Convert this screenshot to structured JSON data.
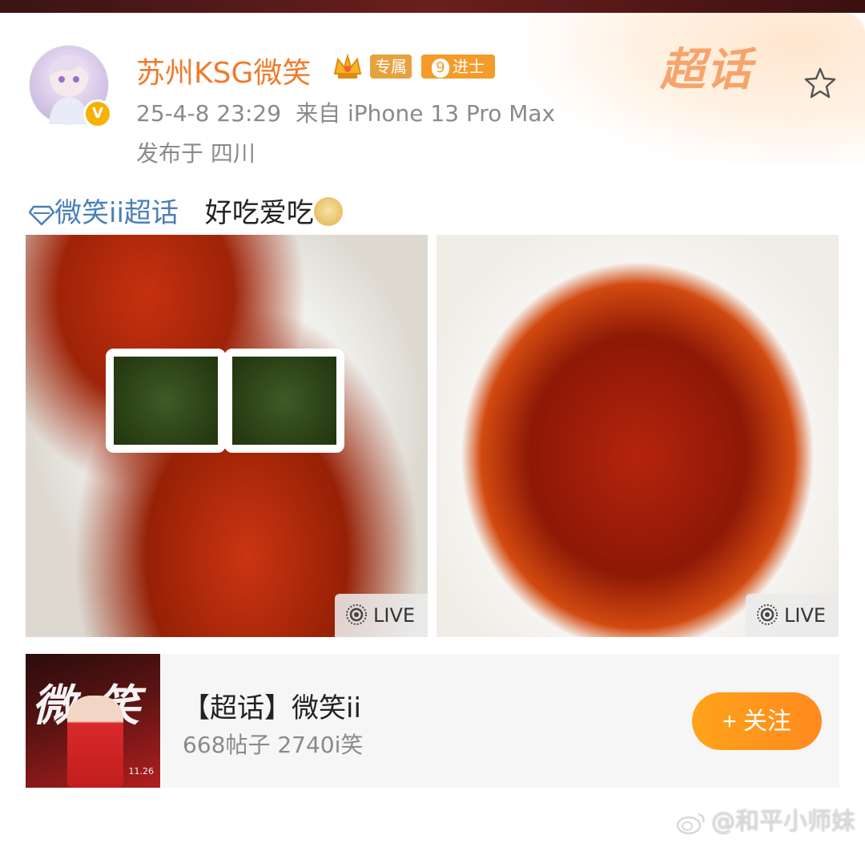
{
  "post": {
    "username": "苏州KSG微笑",
    "badges": {
      "exclusive": "专属",
      "level": "9",
      "level_title": "进士"
    },
    "datetime": "25-4-8 23:29",
    "source": "来自 iPhone 13 Pro Max",
    "location": "发布于 四川",
    "topic_link": "微笑ii超话",
    "text": "好吃爱吃",
    "header_logo": "超话",
    "icons": {
      "verified": "verified-badge-icon",
      "crown": "crown-icon",
      "star": "star-icon",
      "topic": "diamond-icon",
      "emoji": "doge-emoji"
    }
  },
  "photos": [
    {
      "label": "LIVE"
    },
    {
      "label": "LIVE"
    }
  ],
  "topic_card": {
    "title": "【超话】微笑ii",
    "stats": "668帖子 2740i笑",
    "follow_label": "+ 关注",
    "thumb_text": "微 笑",
    "thumb_date": "11.26"
  },
  "watermark": {
    "text": "@和平小师妹"
  },
  "colors": {
    "username": "#f07b2a",
    "topic_link": "#4a7fb8",
    "follow_button": "#ff9a1f",
    "meta_text": "#8a8a8a"
  }
}
